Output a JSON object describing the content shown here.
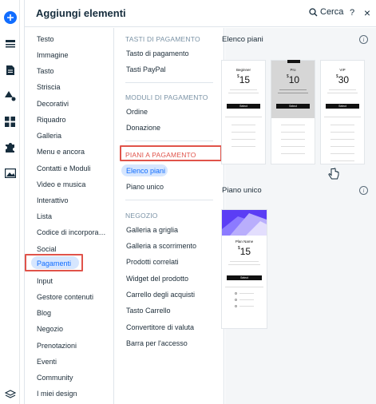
{
  "header": {
    "title": "Aggiungi elementi",
    "search_label": "Cerca",
    "help_icon": "?",
    "close_icon": "×"
  },
  "colors": {
    "accent": "#116dff",
    "highlight_bg": "#d6e6fe",
    "red_box": "#e0534a"
  },
  "rail": {
    "icons": [
      "plus-icon",
      "menu-icon",
      "page-icon",
      "paint-icon",
      "apps-grid-icon",
      "puzzle-icon",
      "image-icon",
      "layers-icon"
    ]
  },
  "categories": [
    "Testo",
    "Immagine",
    "Tasto",
    "Striscia",
    "Decorativi",
    "Riquadro",
    "Galleria",
    "Menu e ancora",
    "Contatti e Moduli",
    "Video e musica",
    "Interattivo",
    "Lista",
    "Codice di incorpora…",
    "Social",
    "Pagamenti",
    "Input",
    "Gestore contenuti",
    "Blog",
    "Negozio",
    "Prenotazioni",
    "Eventi",
    "Community",
    "I miei design"
  ],
  "selected_category": "Pagamenti",
  "sections": {
    "pay_buttons": {
      "title": "TASTI DI PAGAMENTO",
      "items": [
        "Tasto di pagamento",
        "Tasti PayPal"
      ]
    },
    "pay_forms": {
      "title": "MODULI DI PAGAMENTO",
      "items": [
        "Ordine",
        "Donazione"
      ]
    },
    "pay_plans": {
      "title": "PIANI A PAGAMENTO",
      "items": [
        "Elenco piani",
        "Piano unico"
      ]
    },
    "store": {
      "title": "NEGOZIO",
      "items": [
        "Galleria a griglia",
        "Galleria a scorrimento",
        "Prodotti correlati",
        "Widget del prodotto",
        "Carrello degli acquisti",
        "Tasto Carrello",
        "Convertitore di valuta",
        "Barra per l'accesso"
      ]
    }
  },
  "preview": {
    "list_title": "Elenco piani",
    "single_title": "Piano unico",
    "plans": [
      {
        "name": "Beginner",
        "price": "15",
        "currency": "$",
        "button": "Select"
      },
      {
        "name": "Pro",
        "price": "10",
        "currency": "$",
        "button": "Select"
      },
      {
        "name": "VIP",
        "price": "30",
        "currency": "$",
        "button": "Select"
      }
    ],
    "single_plan": {
      "name": "Plan Name",
      "price": "15",
      "currency": "$",
      "button": "Select"
    }
  }
}
